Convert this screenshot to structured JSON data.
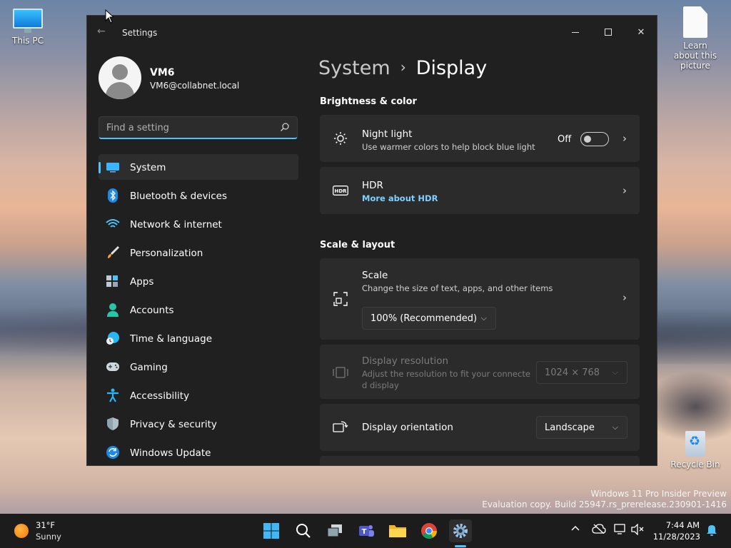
{
  "desktop": {
    "icons": [
      {
        "label": "This PC"
      },
      {
        "label": "Learn about this picture"
      },
      {
        "label": "Recycle Bin"
      }
    ],
    "watermark": {
      "line1": "Windows 11 Pro Insider Preview",
      "line2": "Evaluation copy. Build 25947.rs_prerelease.230901-1416"
    }
  },
  "window": {
    "title": "Settings",
    "controls": {
      "minimize": "minimize",
      "maximize": "maximize",
      "close": "✕"
    }
  },
  "profile": {
    "name": "VM6",
    "email": "VM6@collabnet.local"
  },
  "search": {
    "placeholder": "Find a setting"
  },
  "nav": {
    "items": [
      {
        "label": "System",
        "icon": "system-icon"
      },
      {
        "label": "Bluetooth & devices",
        "icon": "bluetooth-icon"
      },
      {
        "label": "Network & internet",
        "icon": "wifi-icon"
      },
      {
        "label": "Personalization",
        "icon": "brush-icon"
      },
      {
        "label": "Apps",
        "icon": "apps-icon"
      },
      {
        "label": "Accounts",
        "icon": "accounts-icon"
      },
      {
        "label": "Time & language",
        "icon": "globe-clock-icon"
      },
      {
        "label": "Gaming",
        "icon": "gamepad-icon"
      },
      {
        "label": "Accessibility",
        "icon": "accessibility-icon"
      },
      {
        "label": "Privacy & security",
        "icon": "shield-icon"
      },
      {
        "label": "Windows Update",
        "icon": "update-icon"
      }
    ]
  },
  "content": {
    "breadcrumb": {
      "parent": "System",
      "separator": "›",
      "current": "Display"
    },
    "sections": {
      "brightness": "Brightness & color",
      "scale_layout": "Scale & layout"
    },
    "night_light": {
      "title": "Night light",
      "subtitle": "Use warmer colors to help block blue light",
      "toggle_state": "Off"
    },
    "hdr": {
      "title": "HDR",
      "link": "More about HDR"
    },
    "scale": {
      "title": "Scale",
      "subtitle": "Change the size of text, apps, and other items",
      "value": "100% (Recommended)"
    },
    "resolution": {
      "title": "Display resolution",
      "subtitle_line1": "Adjust the resolution to fit your connecte",
      "subtitle_line2": "d display",
      "value": "1024 × 768"
    },
    "orientation": {
      "title": "Display orientation",
      "value": "Landscape"
    }
  },
  "taskbar": {
    "weather": {
      "temp": "31°F",
      "desc": "Sunny"
    },
    "clock": {
      "time": "7:44 AM",
      "date": "11/28/2023"
    }
  },
  "colors": {
    "accent": "#4cc2ff",
    "window_bg": "#202020",
    "card_bg": "#2b2b2b",
    "taskbar_bg": "#1c1c1c"
  }
}
